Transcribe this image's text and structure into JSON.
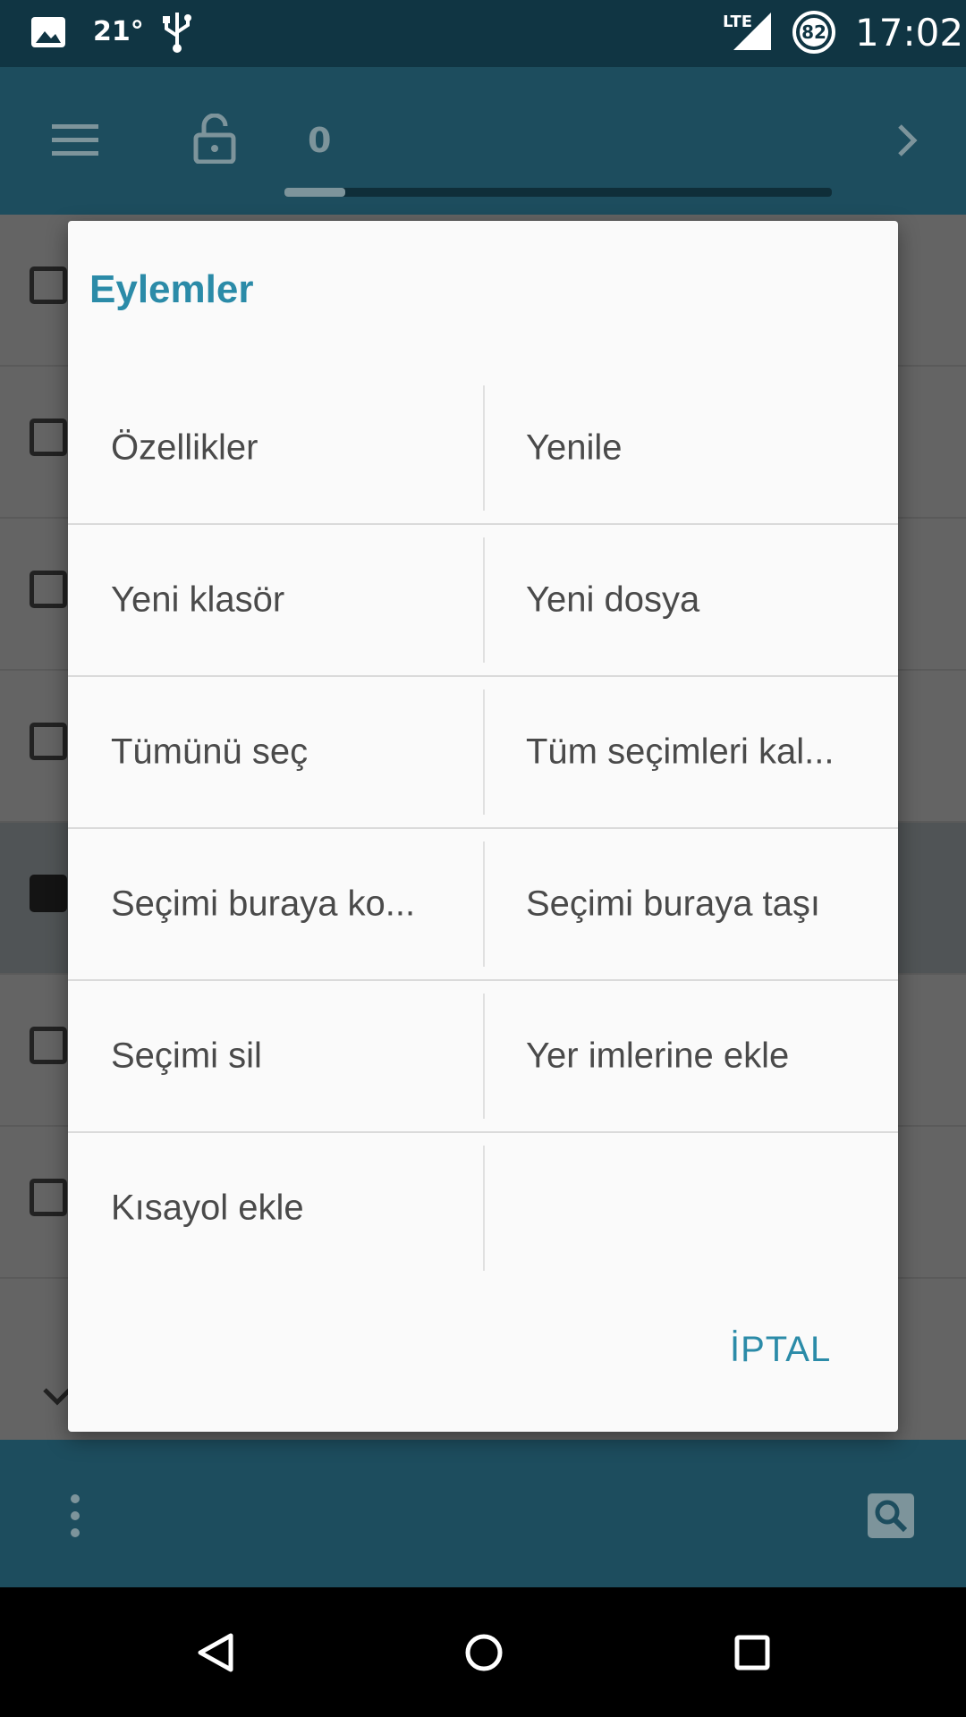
{
  "status_bar": {
    "temperature": "21°",
    "network": "LTE",
    "battery": "82",
    "time": "17:02"
  },
  "toolbar": {
    "tab_count": "0"
  },
  "dialog": {
    "title": "Eylemler",
    "actions": [
      "Özellikler",
      "Yenile",
      "Yeni klasör",
      "Yeni dosya",
      "Tümünü seç",
      "Tüm seçimleri kal...",
      "Seçimi buraya ko...",
      "Seçimi buraya taşı",
      "Seçimi sil",
      "Yer imlerine ekle",
      "Kısayol ekle"
    ],
    "cancel_label": "İPTAL"
  },
  "colors": {
    "accent": "#2b8ba8",
    "toolbar": "#1d4d5e",
    "status_bar": "#103543"
  },
  "icons": [
    "image-icon",
    "usb-icon",
    "signal-icon",
    "battery-icon",
    "menu-icon",
    "lock-icon",
    "chevron-right-icon",
    "chevron-down-icon",
    "more-vert-icon",
    "search-icon",
    "back-icon",
    "home-icon",
    "recents-icon"
  ]
}
